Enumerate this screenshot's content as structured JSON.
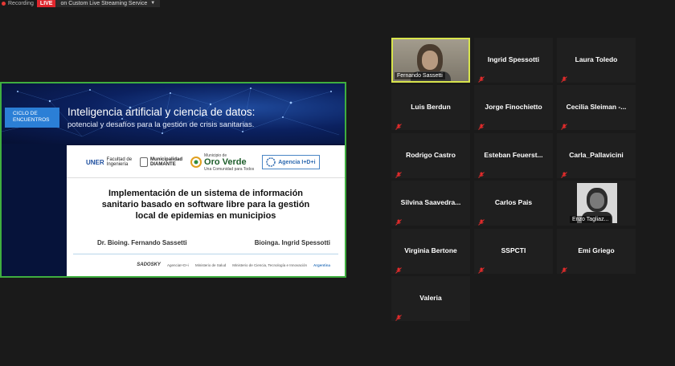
{
  "topbar": {
    "recording_label": "Recording",
    "live_label": "LIVE",
    "stream_label": "on Custom Live Streaming Service"
  },
  "share": {
    "ciclo_label": "CICLO DE\nENCUENTROS",
    "banner_title": "Inteligencia artificial y ciencia de datos:",
    "banner_subtitle": "potencial y desafíos para la gestión de crisis sanitarias.",
    "logo_uner_mark": "UNER",
    "logo_uner_text": "Facultad de\nIngeniería",
    "logo_diamante": "Municipalidad\nDIAMANTE",
    "logo_oro_small": "Municipio de",
    "logo_oro_big": "Oro Verde",
    "logo_oro_tag": "Una Comunidad para Todos",
    "logo_agencia": "Agencia I+D+i",
    "title": "Implementación de un sistema de información sanitario basado en software libre para la gestión local de epidemias en municipios",
    "author_left": "Dr. Bioing. Fernando Sassetti",
    "author_right": "Bioinga. Ingrid Spessotti",
    "footer_logos": [
      "SADOSKY",
      "AgenciaI+D+i",
      "Ministerio de Salud",
      "Ministerio de Ciencia, Tecnología e Innovación",
      "Argentina"
    ]
  },
  "participants": [
    {
      "name": "Fernando Sassetti",
      "video": true,
      "speaking": true
    },
    {
      "name": "Ingrid Spessotti",
      "video": false
    },
    {
      "name": "Laura Toledo",
      "video": false
    },
    {
      "name": "Luis Berdun",
      "video": false
    },
    {
      "name": "Jorge Finochietto",
      "video": false
    },
    {
      "name": "Cecilia  Sleiman  -...",
      "video": false
    },
    {
      "name": "Rodrigo Castro",
      "video": false
    },
    {
      "name": "Esteban  Feuerst...",
      "video": false
    },
    {
      "name": "Carla_Pallavicini",
      "video": false
    },
    {
      "name": "Silvina  Saavedra...",
      "video": false
    },
    {
      "name": "Carlos Pais",
      "video": false
    },
    {
      "name": "Enzo Tagliaz...",
      "video": true
    },
    {
      "name": "Virginia Bertone",
      "video": false
    },
    {
      "name": "SSPCTI",
      "video": false
    },
    {
      "name": "Emi Griego",
      "video": false
    },
    {
      "name": "Valeria",
      "video": false
    }
  ],
  "colors": {
    "mic_muted": "#e02b2b",
    "speaker_border": "#d8e44d",
    "share_border": "#3fae3f"
  }
}
